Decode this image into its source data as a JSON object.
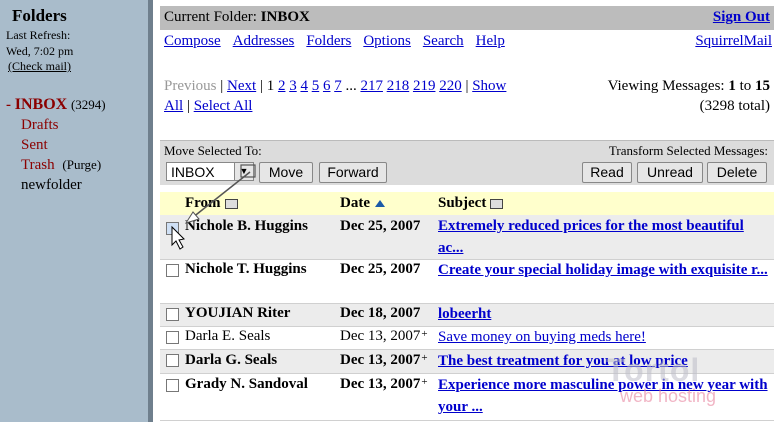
{
  "folders_pane": {
    "title": "Folders",
    "last_refresh_label": "Last Refresh:",
    "last_refresh_time": "Wed, 7:02 pm",
    "check_mail": "(Check mail)",
    "items": [
      {
        "prefix": "- ",
        "label": "INBOX",
        "count": "(3294)",
        "extra": ""
      },
      {
        "prefix": "",
        "label": "Drafts",
        "count": "",
        "extra": ""
      },
      {
        "prefix": "",
        "label": "Sent",
        "count": "",
        "extra": ""
      },
      {
        "prefix": "",
        "label": "Trash",
        "count": "",
        "extra": "(Purge)"
      },
      {
        "prefix": "",
        "label": "newfolder",
        "count": "",
        "extra": ""
      }
    ]
  },
  "header": {
    "current_folder_label": "Current Folder:",
    "current_folder": "INBOX",
    "sign_out": "Sign Out"
  },
  "nav": {
    "links": [
      "Compose",
      "Addresses",
      "Folders",
      "Options",
      "Search",
      "Help"
    ],
    "brand": "SquirrelMail"
  },
  "pagination": {
    "previous": "Previous",
    "next": "Next",
    "pages": [
      "1",
      "2",
      "3",
      "4",
      "5",
      "6",
      "7"
    ],
    "ellipsis": "...",
    "tail_pages": [
      "217",
      "218",
      "219",
      "220"
    ],
    "show": "Show",
    "all": "All",
    "select_all": "Select All",
    "viewing_label": "Viewing Messages:",
    "viewing_from": "1",
    "viewing_to_label": "to",
    "viewing_to": "15",
    "total": "(3298 total)"
  },
  "actions": {
    "move_selected_label": "Move Selected To:",
    "move_target": "INBOX",
    "move_button": "Move",
    "forward_button": "Forward",
    "transform_label": "Transform Selected Messages:",
    "read_button": "Read",
    "unread_button": "Unread",
    "delete_button": "Delete"
  },
  "table": {
    "col_from": "From",
    "col_date": "Date",
    "col_subject": "Subject",
    "rows": [
      {
        "from": "Nichole B. Huggins",
        "date": "Dec 25, 2007",
        "plus": "",
        "subject": "Extremely reduced prices for the most beautiful ac...",
        "unread": true,
        "checked": true
      },
      {
        "from": "Nichole T. Huggins",
        "date": "Dec 25, 2007",
        "plus": "",
        "subject": "Create your special holiday image with exquisite r...",
        "unread": true,
        "checked": false
      },
      {
        "from": "YOUJIAN Riter",
        "date": "Dec 18, 2007",
        "plus": "",
        "subject": "lobeerht",
        "unread": true,
        "checked": false
      },
      {
        "from": "Darla E. Seals",
        "date": "Dec 13, 2007",
        "plus": "+",
        "subject": "Save money on buying meds here!",
        "unread": false,
        "checked": false
      },
      {
        "from": "Darla G. Seals",
        "date": "Dec 13, 2007",
        "plus": "+",
        "subject": "The best treatment for you at low price",
        "unread": true,
        "checked": false
      },
      {
        "from": "Grady N. Sandoval",
        "date": "Dec 13, 2007",
        "plus": "+",
        "subject": "Experience more masculine power in new year with your ...",
        "unread": true,
        "checked": false
      }
    ]
  },
  "watermark": {
    "line1": "Tortol",
    "line2": "web hosting"
  },
  "colors": {
    "left_pane": "#a9bccb",
    "header_bar": "#bcbcbc",
    "link": "#0000cc",
    "folder": "#8b0000",
    "table_header": "#ffffcc"
  }
}
